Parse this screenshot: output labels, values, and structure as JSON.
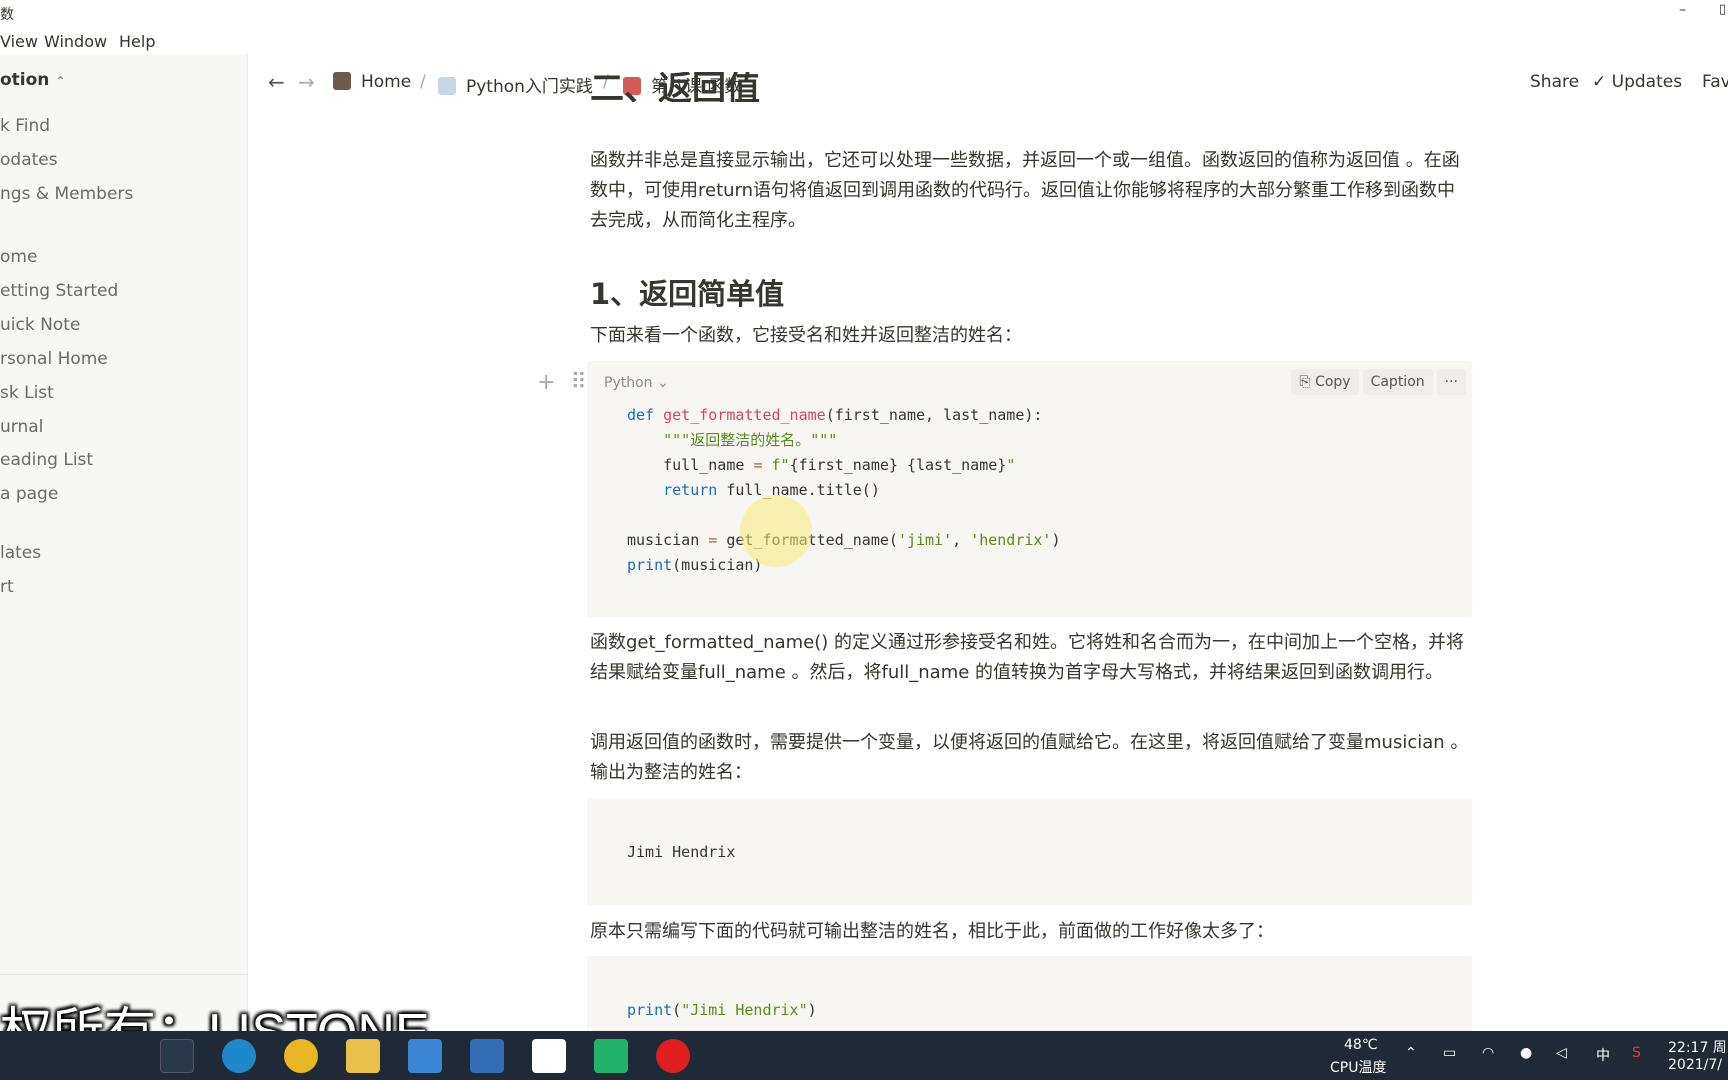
{
  "window": {
    "title_fragment": "数",
    "min_glyph": "–",
    "max_glyph": "▯"
  },
  "menubar": {
    "items": [
      "View",
      "Window",
      "Help"
    ]
  },
  "sidebar": {
    "workspace": "otion",
    "items_top": [
      "k Find",
      "odates",
      "ngs & Members"
    ],
    "items_pages": [
      "ome",
      "etting Started",
      "uick Note",
      "rsonal Home",
      "sk List",
      "urnal",
      "eading List",
      "a page"
    ],
    "items_bottom": [
      "lates",
      "rt"
    ]
  },
  "topbar": {
    "breadcrumbs": [
      "Home",
      "Python入门实践",
      "第八课 函数"
    ],
    "separator": "/",
    "share": "Share",
    "updates": "Updates",
    "favorite": "Fav"
  },
  "doc": {
    "section_heading_cut": "二、返回值",
    "p1": "函数并非总是直接显示输出，它还可以处理一些数据，并返回一个或一组值。函数返回的值称为返回值 。在函数中，可使用return语句将值返回到调用函数的代码行。返回值让你能够将程序的大部分繁重工作移到函数中去完成，从而简化主程序。",
    "h2": "1、返回简单值",
    "p2": "下面来看一个函数，它接受名和姓并返回整洁的姓名：",
    "code_lang": "Python",
    "code_copy": "Copy",
    "code_caption": "Caption",
    "code_more": "···",
    "code_lines": {
      "l1a": "def ",
      "l1b": "get_formatted_name",
      "l1c": "(first_name, last_name):",
      "l2": "    \"\"\"返回整洁的姓名。\"\"\"",
      "l3a": "    full_name ",
      "l3b": "=",
      "l3c": " f\"",
      "l3d": "{first_name} {last_name}",
      "l3e": "\"",
      "l4a": "    return",
      "l4b": " full_name.title()",
      "l6a": "musician ",
      "l6b": "=",
      "l6c": " get_formatted_name(",
      "l6d": "'jimi'",
      "l6e": ", ",
      "l6f": "'hendrix'",
      "l6g": ")",
      "l7a": "print",
      "l7b": "(musician)"
    },
    "p3": "函数get_formatted_name() 的定义通过形参接受名和姓。它将姓和名合而为一，在中间加上一个空格，并将结果赋给变量full_name 。然后，将full_name 的值转换为首字母大写格式，并将结果返回到函数调用行。",
    "p4": "调用返回值的函数时，需要提供一个变量，以便将返回的值赋给它。在这里，将返回值赋给了变量musician 。输出为整洁的姓名：",
    "output": "Jimi Hendrix",
    "p5": "原本只需编写下面的代码就可输出整洁的姓名，相比于此，前面做的工作好像太多了：",
    "code2a": "print",
    "code2b": "(",
    "code2c": "\"Jimi Hendrix\"",
    "code2d": ")"
  },
  "watermark": "权所有：LISTONE",
  "taskbar": {
    "temp": "48℃",
    "temp_label": "CPU温度",
    "ime": "中",
    "time": "22:17 周",
    "date": "2021/7/"
  },
  "colors": {
    "taskbar": "#1f2a36",
    "sidebar": "#f7f7f5",
    "code_bg": "#f7f6f3"
  }
}
